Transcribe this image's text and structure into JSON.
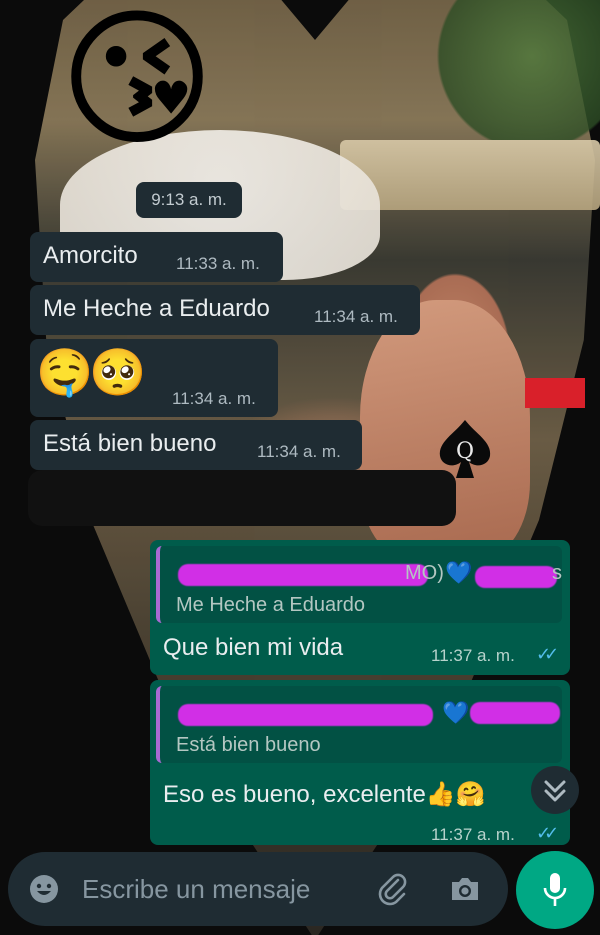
{
  "date_chip": "9:13 a. m.",
  "incoming": [
    {
      "text": "Amorcito",
      "time": "11:33 a. m."
    },
    {
      "text": "Me Heche a Eduardo",
      "time": "11:34 a. m."
    },
    {
      "text": "🤤🥺",
      "time": "11:34 a. m."
    },
    {
      "text": "Está bien bueno",
      "time": "11:34 a. m."
    }
  ],
  "outgoing": [
    {
      "quoted": "Me Heche a Eduardo",
      "text": "Que bien mi vida",
      "time": "11:37 a. m."
    },
    {
      "quoted": "Está bien bueno",
      "text": "Eso es bueno, excelente👍🤗",
      "time": "11:37 a. m."
    }
  ],
  "censored_fragments": [
    "MO)",
    "s"
  ],
  "spade_letter": "Q",
  "composer": {
    "placeholder": "Escribe un mensaje"
  },
  "icons": {
    "emoji": "emoji-face-icon",
    "attach": "paperclip-icon",
    "camera": "camera-icon",
    "mic": "microphone-icon",
    "scroll": "double-chevron-down-icon",
    "ticks": "double-check-icon"
  },
  "colors": {
    "incoming_bubble": "#1f2c33",
    "outgoing_bubble": "#005c4b",
    "accent": "#00a884",
    "read_ticks": "#53bdeb",
    "censor": "#d12fe6"
  }
}
